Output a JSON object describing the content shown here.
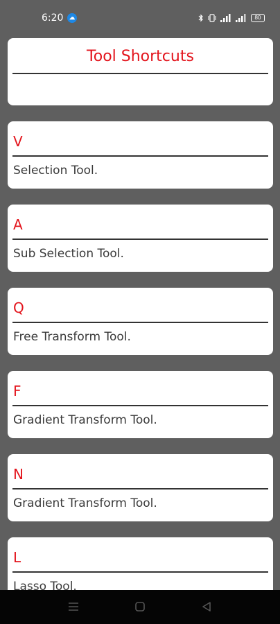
{
  "status": {
    "time": "6:20",
    "battery": "80"
  },
  "header": {
    "title": "Tool Shortcuts"
  },
  "shortcuts": [
    {
      "key": "V",
      "description": "Selection Tool."
    },
    {
      "key": "A",
      "description": "Sub Selection Tool."
    },
    {
      "key": "Q",
      "description": "Free Transform Tool."
    },
    {
      "key": "F",
      "description": "Gradient Transform Tool."
    },
    {
      "key": "N",
      "description": "Gradient Transform Tool."
    },
    {
      "key": "L",
      "description": "Lasso Tool."
    }
  ],
  "colors": {
    "accent": "#e3141c",
    "background": "#5f5f5f",
    "card": "#ffffff"
  },
  "icons": {
    "status_left": "cloud-icon",
    "status_right": [
      "bluetooth-icon",
      "vibrate-icon",
      "signal-icon",
      "signal-icon",
      "battery-icon"
    ],
    "nav": [
      "menu-icon",
      "home-icon",
      "back-icon"
    ]
  }
}
